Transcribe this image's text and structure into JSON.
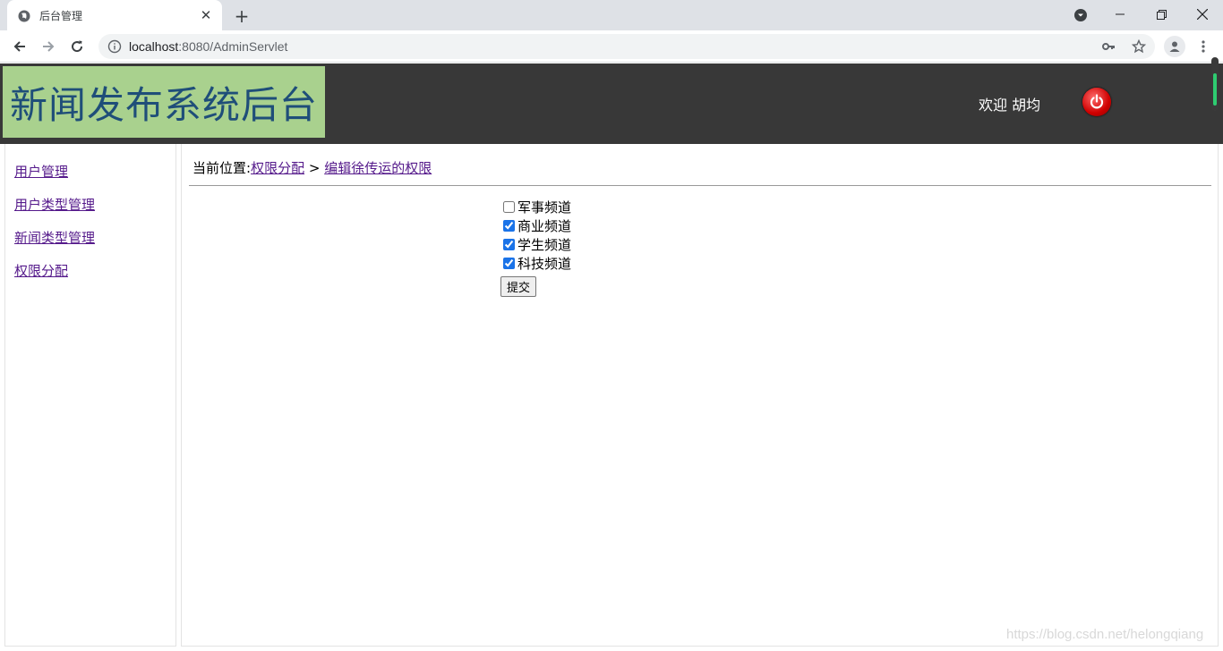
{
  "browser": {
    "tab_title": "后台管理",
    "url_host": "localhost",
    "url_rest": ":8080/AdminServlet"
  },
  "header": {
    "logo_text": "新闻发布系统后台",
    "welcome": "欢迎 胡均",
    "colors": {
      "header_bg": "#383838",
      "logo_bg": "#a9d18e",
      "logo_text": "#1f4e79",
      "power": "#d00000"
    }
  },
  "sidebar": {
    "items": [
      {
        "label": "用户管理"
      },
      {
        "label": "用户类型管理"
      },
      {
        "label": "新闻类型管理"
      },
      {
        "label": "权限分配"
      }
    ]
  },
  "breadcrumb": {
    "prefix": "当前位置:",
    "link1": "权限分配",
    "separator": " > ",
    "link2": "编辑徐传运的权限"
  },
  "form": {
    "channels": [
      {
        "label": "军事频道",
        "checked": false
      },
      {
        "label": "商业频道",
        "checked": true
      },
      {
        "label": "学生频道",
        "checked": true
      },
      {
        "label": "科技频道",
        "checked": true
      }
    ],
    "submit_label": "提交"
  },
  "watermark": "https://blog.csdn.net/helongqiang"
}
